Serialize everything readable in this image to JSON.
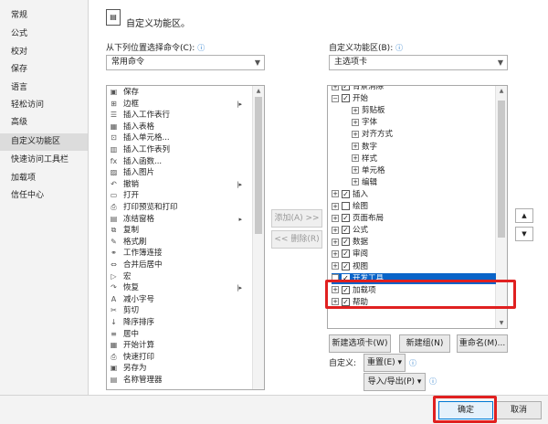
{
  "sidebar": {
    "items": [
      {
        "label": "常规"
      },
      {
        "label": "公式"
      },
      {
        "label": "校对"
      },
      {
        "label": "保存"
      },
      {
        "label": "语言"
      },
      {
        "label": "轻松访问"
      },
      {
        "label": "高级"
      },
      {
        "label": "自定义功能区"
      },
      {
        "label": "快速访问工具栏"
      },
      {
        "label": "加载项"
      },
      {
        "label": "信任中心"
      }
    ],
    "selected": "自定义功能区"
  },
  "header": {
    "title": "自定义功能区。"
  },
  "left": {
    "choose_label": "从下列位置选择命令(C):",
    "dropdown_value": "常用命令",
    "commands": [
      {
        "icon": "save-icon",
        "label": "保存",
        "glyph": "▣"
      },
      {
        "icon": "border-icon",
        "label": "边框",
        "glyph": "⊞",
        "sub": "|▸"
      },
      {
        "icon": "insert-row-icon",
        "label": "插入工作表行",
        "glyph": "☰"
      },
      {
        "icon": "insert-table-icon",
        "label": "插入表格",
        "glyph": "▦"
      },
      {
        "icon": "insert-cell-icon",
        "label": "插入单元格...",
        "glyph": "⊡"
      },
      {
        "icon": "insert-column-icon",
        "label": "插入工作表列",
        "glyph": "▥"
      },
      {
        "icon": "function-icon",
        "label": "插入函数...",
        "glyph": "fx"
      },
      {
        "icon": "picture-icon",
        "label": "插入图片",
        "glyph": "▨"
      },
      {
        "icon": "undo-icon",
        "label": "撤销",
        "glyph": "↶",
        "sub": "|▸"
      },
      {
        "icon": "open-icon",
        "label": "打开",
        "glyph": "▭"
      },
      {
        "icon": "print-preview-icon",
        "label": "打印预览和打印",
        "glyph": "⎙"
      },
      {
        "icon": "freeze-icon",
        "label": "冻结窗格",
        "glyph": "▤",
        "sub": "▸"
      },
      {
        "icon": "copy-icon",
        "label": "复制",
        "glyph": "⧉"
      },
      {
        "icon": "format-painter-icon",
        "label": "格式刷",
        "glyph": "✎"
      },
      {
        "icon": "workbook-link-icon",
        "label": "工作簿连接",
        "glyph": "⚭"
      },
      {
        "icon": "merge-center-icon",
        "label": "合并后居中",
        "glyph": "⇔"
      },
      {
        "icon": "macro-icon",
        "label": "宏",
        "glyph": "▷"
      },
      {
        "icon": "redo-icon",
        "label": "恢复",
        "glyph": "↷",
        "sub": "|▸"
      },
      {
        "icon": "decrease-font-icon",
        "label": "减小字号",
        "glyph": "A"
      },
      {
        "icon": "cut-icon",
        "label": "剪切",
        "glyph": "✂"
      },
      {
        "icon": "sort-desc-icon",
        "label": "降序排序",
        "glyph": "↓"
      },
      {
        "icon": "center-icon",
        "label": "居中",
        "glyph": "≡"
      },
      {
        "icon": "calculate-icon",
        "label": "开始计算",
        "glyph": "▦"
      },
      {
        "icon": "quick-print-icon",
        "label": "快速打印",
        "glyph": "⎙"
      },
      {
        "icon": "save-as-icon",
        "label": "另存为",
        "glyph": "▣"
      },
      {
        "icon": "name-manager-icon",
        "label": "名称管理器",
        "glyph": "▤"
      }
    ]
  },
  "middle": {
    "add": "添加(A) >>",
    "remove": "<< 删除(R)"
  },
  "right": {
    "customize_label": "自定义功能区(B):",
    "dropdown_value": "主选项卡",
    "tree": [
      {
        "label": "背景消除",
        "level": 0,
        "pm": "+",
        "checked": true
      },
      {
        "label": "开始",
        "level": 0,
        "pm": "−",
        "checked": true
      },
      {
        "label": "剪贴板",
        "level": 1,
        "pm": "+"
      },
      {
        "label": "字体",
        "level": 1,
        "pm": "+"
      },
      {
        "label": "对齐方式",
        "level": 1,
        "pm": "+"
      },
      {
        "label": "数字",
        "level": 1,
        "pm": "+"
      },
      {
        "label": "样式",
        "level": 1,
        "pm": "+"
      },
      {
        "label": "单元格",
        "level": 1,
        "pm": "+"
      },
      {
        "label": "编辑",
        "level": 1,
        "pm": "+"
      },
      {
        "label": "插入",
        "level": 0,
        "pm": "+",
        "checked": true
      },
      {
        "label": "绘图",
        "level": 0,
        "pm": "+",
        "checked": false
      },
      {
        "label": "页面布局",
        "level": 0,
        "pm": "+",
        "checked": true
      },
      {
        "label": "公式",
        "level": 0,
        "pm": "+",
        "checked": true
      },
      {
        "label": "数据",
        "level": 0,
        "pm": "+",
        "checked": true
      },
      {
        "label": "审阅",
        "level": 0,
        "pm": "+",
        "checked": true
      },
      {
        "label": "视图",
        "level": 0,
        "pm": "+",
        "checked": true
      },
      {
        "label": "开发工具",
        "level": 0,
        "pm": "+",
        "checked": true,
        "selected": true
      },
      {
        "label": "加载项",
        "level": 0,
        "pm": "+",
        "checked": true
      },
      {
        "label": "帮助",
        "level": 0,
        "pm": "+",
        "checked": true
      }
    ],
    "new_tab": "新建选项卡(W)",
    "new_group": "新建组(N)",
    "rename": "重命名(M)...",
    "customizations_label": "自定义:",
    "reset": "重置(E) ▾",
    "import_export": "导入/导出(P) ▾"
  },
  "footer": {
    "ok": "确定",
    "cancel": "取消"
  },
  "colors": {
    "highlight": "#0a64c8",
    "red": "#e02020"
  }
}
